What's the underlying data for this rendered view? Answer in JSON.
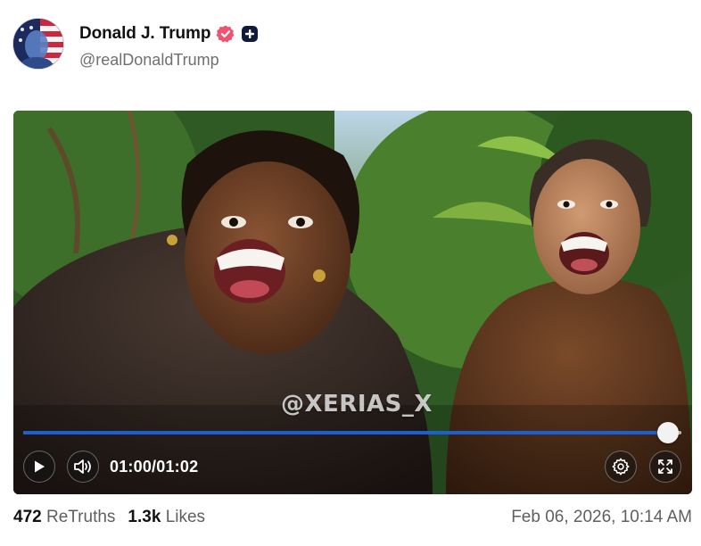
{
  "author": {
    "display_name": "Donald J. Trump",
    "handle": "@realDonaldTrump",
    "verified_icon": "verified-badge-icon",
    "verified_color": "#f1536e",
    "plus_badge_icon": "plus-badge-icon"
  },
  "video": {
    "watermark": "@XERIAS_X",
    "progress": 0.98,
    "time_current": "01:00",
    "time_separator": "/",
    "time_total": "01:02",
    "accent_color": "#1d5fd1",
    "controls": {
      "play_icon": "play-icon",
      "volume_icon": "volume-icon",
      "settings_icon": "gear-icon",
      "fullscreen_icon": "fullscreen-icon"
    }
  },
  "stats": {
    "retruths_count": "472",
    "retruths_label": "ReTruths",
    "likes_count": "1.3k",
    "likes_label": "Likes"
  },
  "timestamp": "Feb 06, 2026, 10:14 AM"
}
